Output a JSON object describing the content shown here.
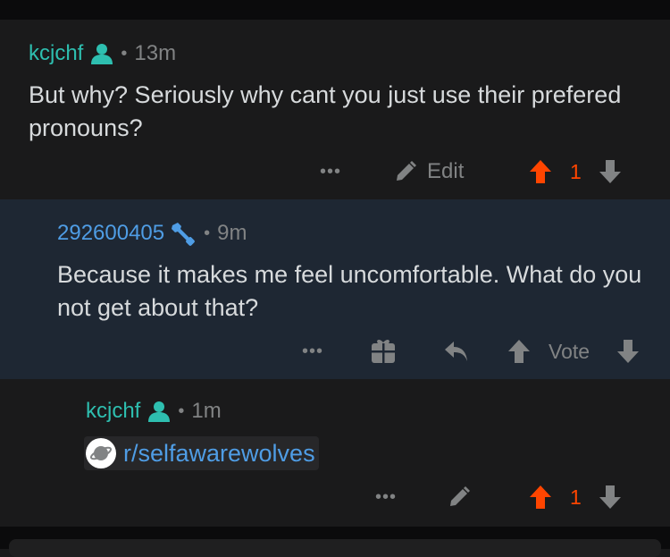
{
  "comments": [
    {
      "username": "kcjchf",
      "time": "13m",
      "body": "But why? Seriously why cant you just use their prefered pronouns?",
      "edit_label": "Edit",
      "vote_count": "1",
      "more": "•••"
    },
    {
      "username": "292600405",
      "time": "9m",
      "body": "Because it makes me feel uncomfortable. What do you not get about that?",
      "vote_label": "Vote",
      "more": "•••"
    },
    {
      "username": "kcjchf",
      "time": "1m",
      "link_text": "r/selfawarewolves",
      "vote_count": "1",
      "more": "•••"
    }
  ],
  "colors": {
    "accent_teal": "#2ebfb0",
    "username_blue": "#4f9de5",
    "upvote_orange": "#ff4500",
    "muted": "#818384",
    "reply_bg": "#1e2733"
  },
  "icons": [
    "user-icon",
    "mod-wrench-icon",
    "pencil-icon",
    "upvote-arrow-icon",
    "downvote-arrow-icon",
    "gift-icon",
    "reply-arrow-icon",
    "subreddit-planet-icon"
  ]
}
